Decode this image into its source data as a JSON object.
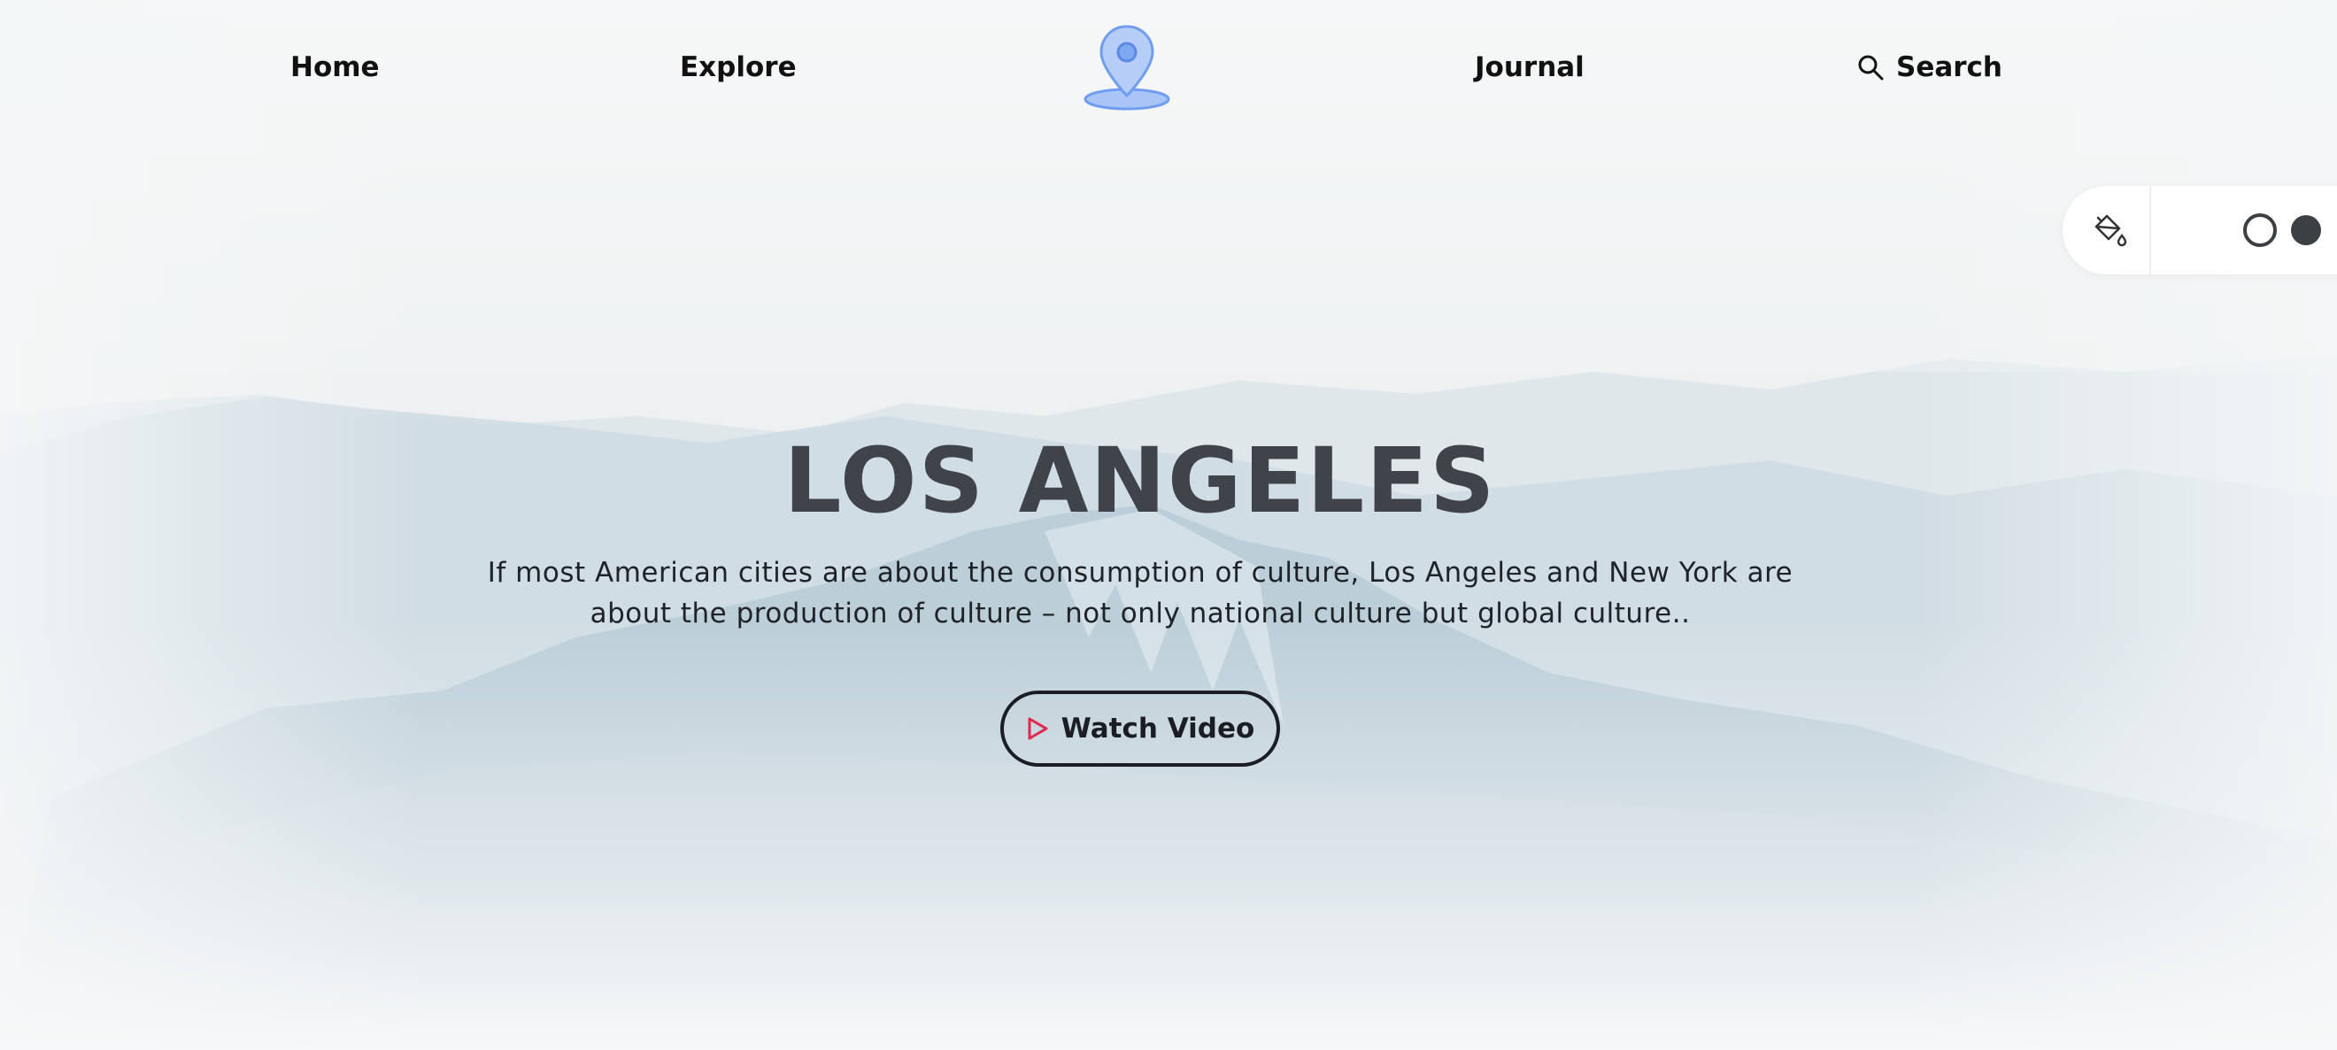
{
  "nav": {
    "home": "Home",
    "explore": "Explore",
    "journal": "Journal",
    "search": "Search"
  },
  "hero": {
    "title": "LOS ANGELES",
    "description": "If most American cities are about the consumption of culture, Los Angeles and New York are about the production of culture – not only national culture but global culture..",
    "button_label": "Watch Video"
  },
  "icons": {
    "logo": "map-pin-icon",
    "search": "search-icon",
    "theme": "paint-bucket-icon",
    "play": "play-icon"
  },
  "colors": {
    "accent_blue": "#6f9df0",
    "play_red": "#e0284f",
    "title_gray": "#40444a",
    "swatch_dark": "#3b4045"
  }
}
